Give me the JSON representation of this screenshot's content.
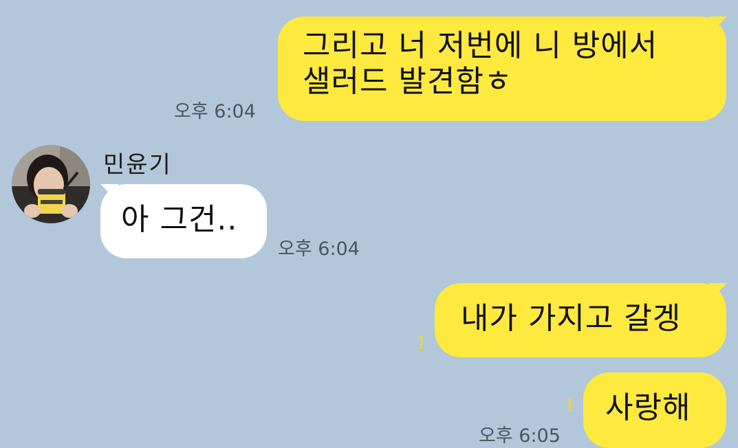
{
  "colors": {
    "chat_background": "#b2c7da",
    "my_bubble": "#fee93f",
    "their_bubble": "#ffffff",
    "unread_count": "#f2d433"
  },
  "messages": [
    {
      "from": "me",
      "lines": [
        "그리고 너 저번에 니 방에서",
        "샐러드 발견함ㅎ"
      ],
      "time": "오후 6:04"
    },
    {
      "from": "other",
      "sender": "민윤기",
      "avatar_icon": "profile-photo",
      "text": "아 그건..",
      "time": "오후 6:04"
    },
    {
      "from": "me",
      "text": "내가 가지고 갈겡",
      "unread": "1"
    },
    {
      "from": "me",
      "text": "사랑해",
      "unread": "1",
      "time": "오후 6:05"
    }
  ]
}
